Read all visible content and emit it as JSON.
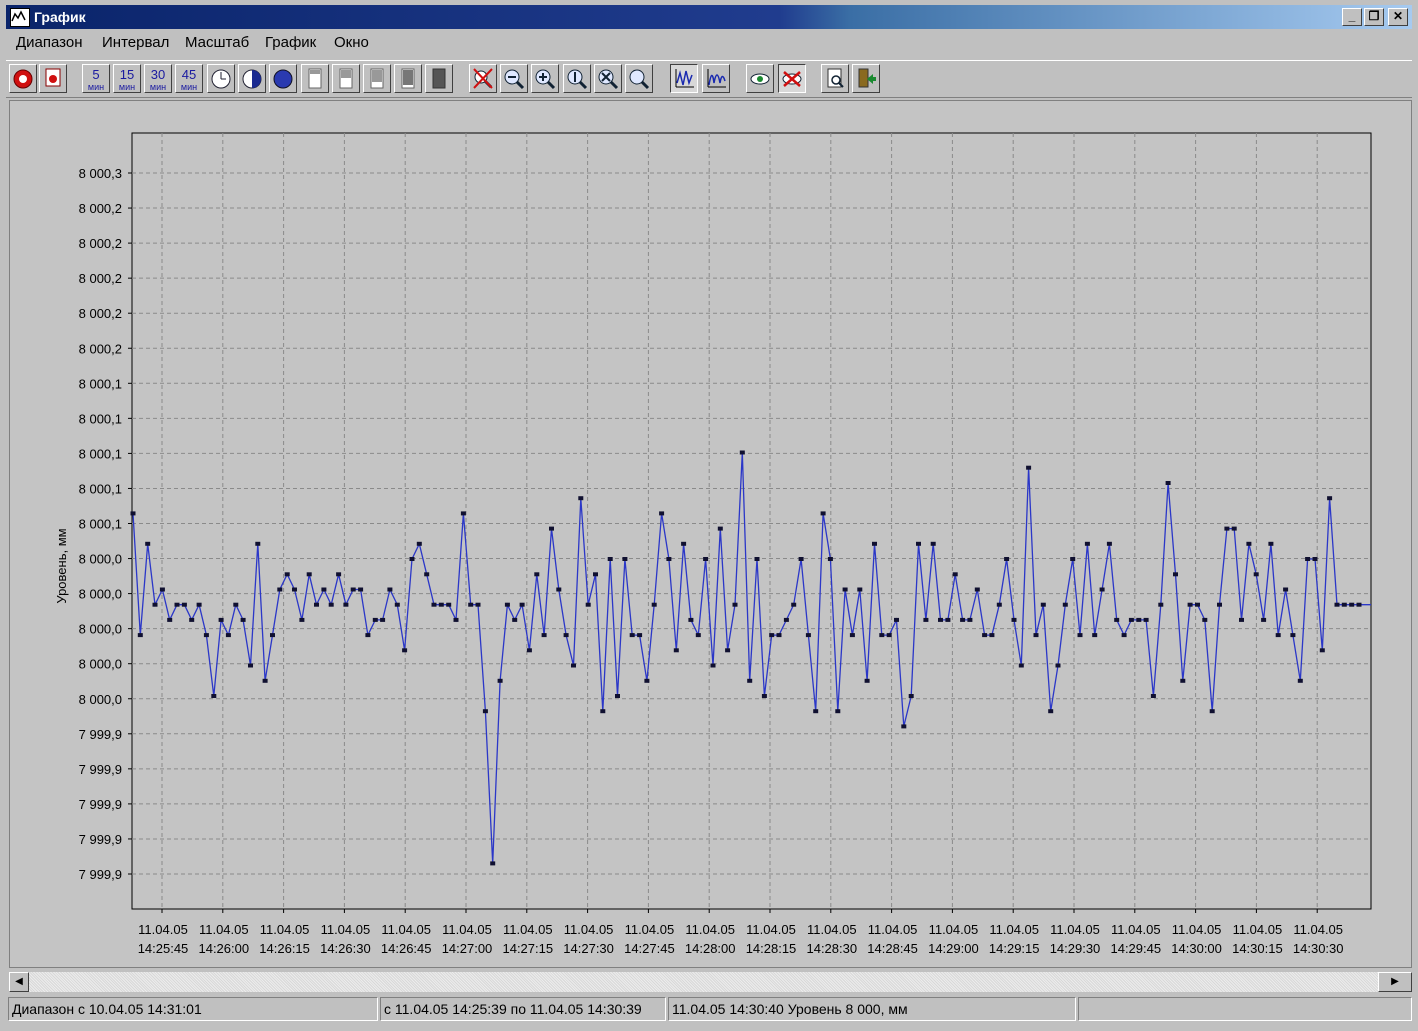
{
  "window": {
    "title": "График",
    "minimize": "_",
    "restore": "❐",
    "close": "✕"
  },
  "menu": [
    "Диапазон",
    "Интервал",
    "Масштаб",
    "График",
    "Окно"
  ],
  "toolbar": {
    "interval_buttons": [
      {
        "top": "5",
        "bottom": "мин"
      },
      {
        "top": "15",
        "bottom": "мин"
      },
      {
        "top": "30",
        "bottom": "мин"
      },
      {
        "top": "45",
        "bottom": "мин"
      }
    ]
  },
  "colors": {
    "line": "#2b37c8",
    "marker": "#101030",
    "plot_bg": "#c4c4c4",
    "grid": "#8a8a8a"
  },
  "chart_data": {
    "type": "line",
    "ylabel": "Уровень, мм",
    "ytick_labels": [
      "8 000,3",
      "8 000,2",
      "8 000,2",
      "8 000,2",
      "8 000,2",
      "8 000,2",
      "8 000,1",
      "8 000,1",
      "8 000,1",
      "8 000,1",
      "8 000,1",
      "8 000,0",
      "8 000,0",
      "8 000,0",
      "8 000,0",
      "8 000,0",
      "7 999,9",
      "7 999,9",
      "7 999,9",
      "7 999,9",
      "7 999,9"
    ],
    "ylim": [
      7999.82,
      8000.33
    ],
    "xtick_dates": [
      "11.04.05",
      "11.04.05",
      "11.04.05",
      "11.04.05",
      "11.04.05",
      "11.04.05",
      "11.04.05",
      "11.04.05",
      "11.04.05",
      "11.04.05",
      "11.04.05",
      "11.04.05",
      "11.04.05",
      "11.04.05",
      "11.04.05",
      "11.04.05",
      "11.04.05",
      "11.04.05",
      "11.04.05",
      "11.04.05"
    ],
    "xtick_times": [
      "14:25:45",
      "14:26:00",
      "14:26:15",
      "14:26:30",
      "14:26:45",
      "14:27:00",
      "14:27:15",
      "14:27:30",
      "14:27:45",
      "14:28:00",
      "14:28:15",
      "14:28:30",
      "14:28:45",
      "14:29:00",
      "14:29:15",
      "14:29:30",
      "14:29:45",
      "14:30:00",
      "14:30:15",
      "14:30:30"
    ],
    "grid": true,
    "series": [
      {
        "values": [
          8000.08,
          8000.0,
          8000.06,
          8000.02,
          8000.03,
          8000.01,
          8000.02,
          8000.02,
          8000.01,
          8000.02,
          8000.0,
          7999.96,
          8000.01,
          8000.0,
          8000.02,
          8000.01,
          7999.98,
          8000.06,
          7999.97,
          8000.0,
          8000.03,
          8000.04,
          8000.03,
          8000.01,
          8000.04,
          8000.02,
          8000.03,
          8000.02,
          8000.04,
          8000.02,
          8000.03,
          8000.03,
          8000.0,
          8000.01,
          8000.01,
          8000.03,
          8000.02,
          7999.99,
          8000.05,
          8000.06,
          8000.04,
          8000.02,
          8000.02,
          8000.02,
          8000.01,
          8000.08,
          8000.02,
          8000.02,
          7999.95,
          7999.85,
          7999.97,
          8000.02,
          8000.01,
          8000.02,
          7999.99,
          8000.04,
          8000.0,
          8000.07,
          8000.03,
          8000.0,
          7999.98,
          8000.09,
          8000.02,
          8000.04,
          7999.95,
          8000.05,
          7999.96,
          8000.05,
          8000.0,
          8000.0,
          7999.97,
          8000.02,
          8000.08,
          8000.05,
          7999.99,
          8000.06,
          8000.01,
          8000.0,
          8000.05,
          7999.98,
          8000.07,
          7999.99,
          8000.02,
          8000.12,
          7999.97,
          8000.05,
          7999.96,
          8000.0,
          8000.0,
          8000.01,
          8000.02,
          8000.05,
          8000.0,
          7999.95,
          8000.08,
          8000.05,
          7999.95,
          8000.03,
          8000.0,
          8000.03,
          7999.97,
          8000.06,
          8000.0,
          8000.0,
          8000.01,
          7999.94,
          7999.96,
          8000.06,
          8000.01,
          8000.06,
          8000.01,
          8000.01,
          8000.04,
          8000.01,
          8000.01,
          8000.03,
          8000.0,
          8000.0,
          8000.02,
          8000.05,
          8000.01,
          7999.98,
          8000.11,
          8000.0,
          8000.02,
          7999.95,
          7999.98,
          8000.02,
          8000.05,
          8000.0,
          8000.06,
          8000.0,
          8000.03,
          8000.06,
          8000.01,
          8000.0,
          8000.01,
          8000.01,
          8000.01,
          7999.96,
          8000.02,
          8000.1,
          8000.04,
          7999.97,
          8000.02,
          8000.02,
          8000.01,
          7999.95,
          8000.02,
          8000.07,
          8000.07,
          8000.01,
          8000.06,
          8000.04,
          8000.01,
          8000.06,
          8000.0,
          8000.03,
          8000.0,
          7999.97,
          8000.05,
          8000.05,
          7999.99,
          8000.09,
          8000.02,
          8000.02,
          8000.02,
          8000.02
        ]
      }
    ]
  },
  "status": {
    "range": "Диапазон с 10.04.05 14:31:01",
    "period": "с 11.04.05 14:25:39 по 11.04.05 14:30:39",
    "cursor": "11.04.05 14:30:40 Уровень 8 000, мм",
    "extra": ""
  }
}
